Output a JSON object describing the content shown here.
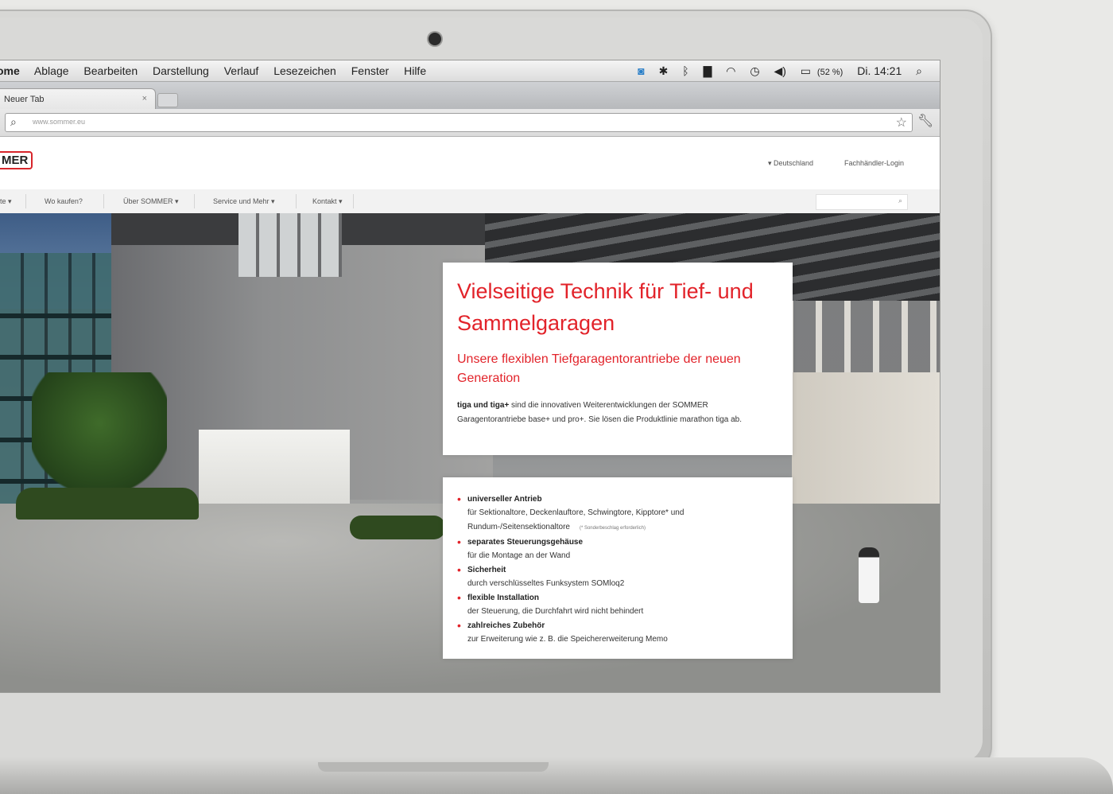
{
  "menubar": {
    "app_partial": "ome",
    "menus": [
      "Ablage",
      "Bearbeiten",
      "Darstellung",
      "Verlauf",
      "Lesezeichen",
      "Fenster",
      "Hilfe"
    ],
    "battery": "(52 %)",
    "clock": "Di. 14:21"
  },
  "browser": {
    "tab_title": "Neuer Tab",
    "tab_close": "×",
    "url": "www.sommer.eu"
  },
  "site": {
    "logo_partial": "MER",
    "header_links": [
      "Deutschland",
      "Fachhändler-Login"
    ],
    "nav": [
      "te",
      "Wo kaufen?",
      "Über SOMMER",
      "Service und Mehr",
      "Kontakt"
    ]
  },
  "hero": {
    "headline": "Vielseitige Technik für Tief- und Sammelgaragen",
    "subheadline": "Unsere flexiblen Tiefgaragentorantriebe der neuen Generation",
    "intro_bold": "tiga und tiga+",
    "intro_text": " sind die innovativen Weiterentwicklungen der SOMMER Garagentorantriebe base+ und pro+. Sie lösen die Produktlinie marathon tiga ab.",
    "features": [
      {
        "title": "universeller Antrieb",
        "desc": "für Sektionaltore, Deckenlauftore, Schwingtore, Kipptore* und",
        "desc2": "Rundum-/Seitensektionaltore",
        "note": "(* Sonderbeschlag erforderlich)"
      },
      {
        "title": "separates Steuerungsgehäuse",
        "desc": "für die Montage an der Wand"
      },
      {
        "title": "Sicherheit",
        "desc": "durch verschlüsseltes Funksystem SOMloq2"
      },
      {
        "title": "flexible Installation",
        "desc": "der Steuerung, die Durchfahrt wird nicht behindert"
      },
      {
        "title": "zahlreiches Zubehör",
        "desc": "zur Erweiterung wie z. B. die Speichererweiterung Memo"
      }
    ]
  },
  "colors": {
    "brand_red": "#e2232a"
  }
}
